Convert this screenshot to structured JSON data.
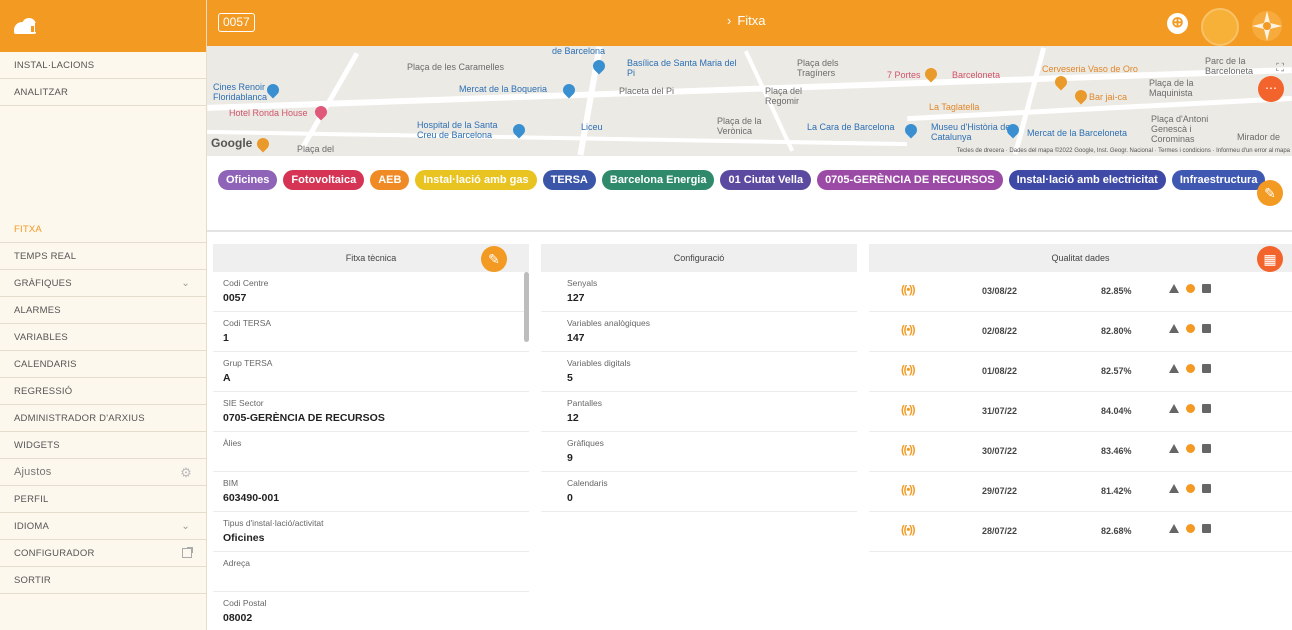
{
  "app": {
    "code": "0057",
    "page_title": "Fitxa",
    "colors": {
      "accent": "#f39a22",
      "red": "#f2642b"
    }
  },
  "sidebar": {
    "top_items": [
      {
        "label": "INSTAL·LACIONS"
      },
      {
        "label": "ANALITZAR"
      }
    ],
    "items": [
      {
        "label": "FITXA",
        "active": true
      },
      {
        "label": "TEMPS REAL"
      },
      {
        "label": "GRÀFIQUES",
        "chevron": true
      },
      {
        "label": "ALARMES"
      },
      {
        "label": "VARIABLES"
      },
      {
        "label": "CALENDARIS"
      },
      {
        "label": "REGRESSIÓ"
      },
      {
        "label": "ADMINISTRADOR D'ARXIUS"
      },
      {
        "label": "WIDGETS"
      },
      {
        "label": "Ajustos",
        "icon": "gear-icon"
      },
      {
        "label": "PERFIL"
      },
      {
        "label": "IDIOMA",
        "chevron": true
      },
      {
        "label": "CONFIGURADOR",
        "icon": "external-link-icon"
      },
      {
        "label": "SORTIR"
      }
    ]
  },
  "map": {
    "labels": [
      "Plaça de les Caramelles",
      "Basílica de Santa Maria del Pi",
      "Plaça dels Tragíners",
      "Cines Renoir Floridablanca",
      "Mercat de la Boqueria",
      "Placeta del Pi",
      "Plaça del Regomir",
      "Hotel Ronda House",
      "Hospital de la Santa Creu de Barcelona",
      "Liceu",
      "Plaça de la Verònica",
      "La Cara de Barcelona",
      "7 Portes",
      "Barceloneta",
      "Cerveseria Vaso de Oro",
      "Plaça de la Maquinista",
      "Bar jai-ca",
      "La Taglatella",
      "Museu d'Història de Catalunya",
      "Mercat de la Barceloneta",
      "Plaça d'Antoni Genescà i Corominas",
      "Parc de la Barceloneta",
      "Mirador de",
      "Plaça del",
      "de Barcelona",
      "Liceu"
    ],
    "google": "Google",
    "attribution": "Tecles de drecera · Dades del mapa ©2022 Google, Inst. Geogr. Nacional · Termes i condicions · Informeu d'un error al mapa"
  },
  "tags": [
    {
      "label": "Oficines",
      "color": "#8e63b8"
    },
    {
      "label": "Fotovoltaica",
      "color": "#d63455"
    },
    {
      "label": "AEB",
      "color": "#f08a24"
    },
    {
      "label": "Instal·lació amb gas",
      "color": "#e9c320"
    },
    {
      "label": "TERSA",
      "color": "#3b56a8"
    },
    {
      "label": "Barcelona Energia",
      "color": "#2e8a6a"
    },
    {
      "label": "01 Ciutat Vella",
      "color": "#5c4aa0"
    },
    {
      "label": "0705-GERÈNCIA DE RECURSOS",
      "color": "#9b4aa6"
    },
    {
      "label": "Instal·lació amb electricitat",
      "color": "#3f4aa6"
    },
    {
      "label": "Infraestructura",
      "color": "#3f58b2"
    }
  ],
  "fitxa": {
    "title": "Fitxa tècnica",
    "fields": [
      {
        "label": "Codi Centre",
        "value": "0057"
      },
      {
        "label": "Codi TERSA",
        "value": "1"
      },
      {
        "label": "Grup TERSA",
        "value": "A"
      },
      {
        "label": "SIE Sector",
        "value": "0705-GERÈNCIA DE RECURSOS"
      },
      {
        "label": "Àlies",
        "value": ""
      },
      {
        "label": "BIM",
        "value": "603490-001"
      },
      {
        "label": "Tipus d'instal·lació/activitat",
        "value": "Oficines"
      },
      {
        "label": "Adreça",
        "value": ""
      },
      {
        "label": "Codi Postal",
        "value": "08002"
      }
    ]
  },
  "config": {
    "title": "Configuració",
    "fields": [
      {
        "label": "Senyals",
        "value": "127"
      },
      {
        "label": "Variables analògiques",
        "value": "147"
      },
      {
        "label": "Variables digitals",
        "value": "5"
      },
      {
        "label": "Pantalles",
        "value": "12"
      },
      {
        "label": "Gràfiques",
        "value": "9"
      },
      {
        "label": "Calendaris",
        "value": "0"
      }
    ]
  },
  "quality": {
    "title": "Qualitat dades",
    "signal_glyph": "((•))",
    "rows": [
      {
        "date": "03/08/22",
        "pct": "82.85%"
      },
      {
        "date": "02/08/22",
        "pct": "82.80%"
      },
      {
        "date": "01/08/22",
        "pct": "82.57%"
      },
      {
        "date": "31/07/22",
        "pct": "84.04%"
      },
      {
        "date": "30/07/22",
        "pct": "83.46%"
      },
      {
        "date": "29/07/22",
        "pct": "81.42%"
      },
      {
        "date": "28/07/22",
        "pct": "82.68%"
      }
    ]
  }
}
